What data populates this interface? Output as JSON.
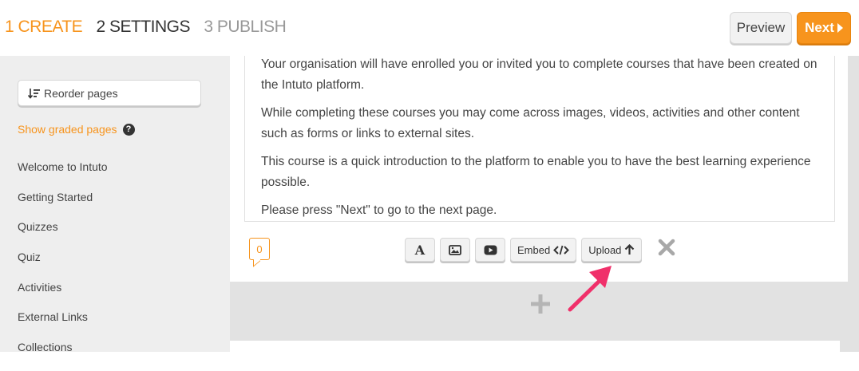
{
  "header": {
    "steps": [
      {
        "label": "1 CREATE",
        "state": "active"
      },
      {
        "label": "2 SETTINGS",
        "state": "normal"
      },
      {
        "label": "3 PUBLISH",
        "state": "inactive"
      }
    ],
    "preview_label": "Preview",
    "next_label": "Next"
  },
  "sidebar": {
    "reorder_label": "Reorder pages",
    "show_graded_label": "Show graded pages",
    "help_glyph": "?",
    "pages": [
      "Welcome to Intuto",
      "Getting Started",
      "Quizzes",
      "Quiz",
      "Activities",
      "External Links",
      "Collections"
    ]
  },
  "content": {
    "paragraphs": [
      "Your organisation will have enrolled you or invited you to complete courses that have been created on the Intuto platform.",
      "While completing these courses you may come across images, videos, activities and other content such as forms or links to external sites.",
      "This course is a quick introduction to the platform to enable you to have the best learning experience possible.",
      "Please press \"Next\" to go to the next page."
    ],
    "comment_count": "0",
    "toolbar": {
      "text_glyph": "A",
      "embed_label": "Embed",
      "upload_label": "Upload"
    }
  },
  "colors": {
    "accent": "#f7941d",
    "annotation_arrow": "#f0306a"
  },
  "icons": [
    "sort-icon",
    "question-circle-icon",
    "text-icon",
    "image-icon",
    "video-icon",
    "code-icon",
    "arrow-up-icon",
    "close-icon",
    "plus-icon"
  ]
}
